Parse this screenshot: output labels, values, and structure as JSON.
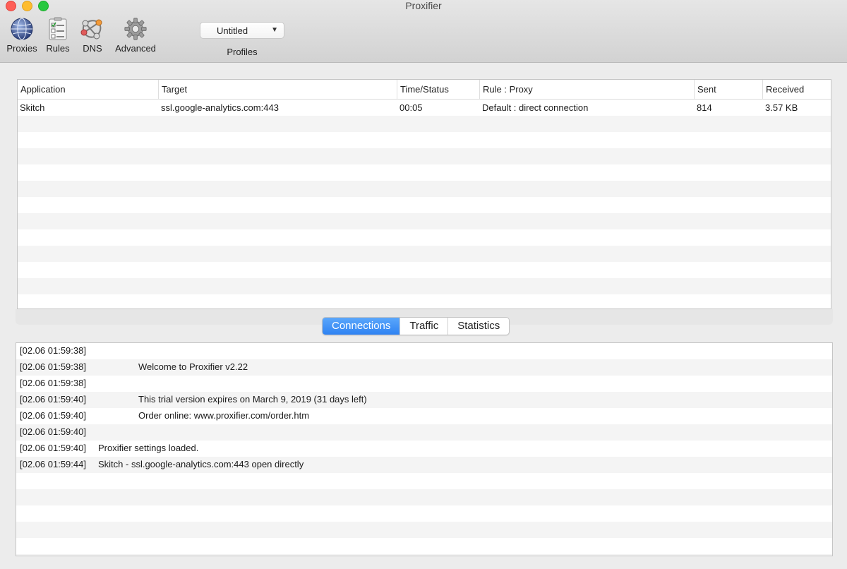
{
  "window": {
    "title": "Proxifier"
  },
  "toolbar": {
    "items": [
      {
        "label": "Proxies",
        "icon": "globe-icon"
      },
      {
        "label": "Rules",
        "icon": "checklist-icon"
      },
      {
        "label": "DNS",
        "icon": "network-nodes-icon"
      },
      {
        "label": "Advanced",
        "icon": "gear-icon"
      }
    ],
    "profiles": {
      "selected": "Untitled",
      "label": "Profiles"
    }
  },
  "connections": {
    "columns": [
      "Application",
      "Target",
      "Time/Status",
      "Rule : Proxy",
      "Sent",
      "Received"
    ],
    "rows": [
      [
        "Skitch",
        "ssl.google-analytics.com:443",
        "00:05",
        "Default : direct connection",
        "814",
        "3.57 KB"
      ]
    ]
  },
  "tabs": [
    {
      "label": "Connections",
      "active": true
    },
    {
      "label": "Traffic",
      "active": false
    },
    {
      "label": "Statistics",
      "active": false
    }
  ],
  "log": [
    {
      "ts": "[02.06 01:59:38]",
      "msg": "",
      "indent": false
    },
    {
      "ts": "[02.06 01:59:38]",
      "msg": "Welcome to Proxifier v2.22",
      "indent": true
    },
    {
      "ts": "[02.06 01:59:38]",
      "msg": "",
      "indent": false
    },
    {
      "ts": "[02.06 01:59:40]",
      "msg": "This trial version expires on March 9, 2019 (31 days left)",
      "indent": true
    },
    {
      "ts": "[02.06 01:59:40]",
      "msg": "Order online: www.proxifier.com/order.htm",
      "indent": true
    },
    {
      "ts": "[02.06 01:59:40]",
      "msg": "",
      "indent": false
    },
    {
      "ts": "[02.06 01:59:40]",
      "msg": "Proxifier settings loaded.",
      "indent": false
    },
    {
      "ts": "[02.06 01:59:44]",
      "msg": "Skitch - ssl.google-analytics.com:443 open directly",
      "indent": false
    }
  ],
  "colors": {
    "accent": "#2e82f2",
    "close": "#fe5f57",
    "minimize": "#febc2e",
    "maximize": "#28c840"
  }
}
